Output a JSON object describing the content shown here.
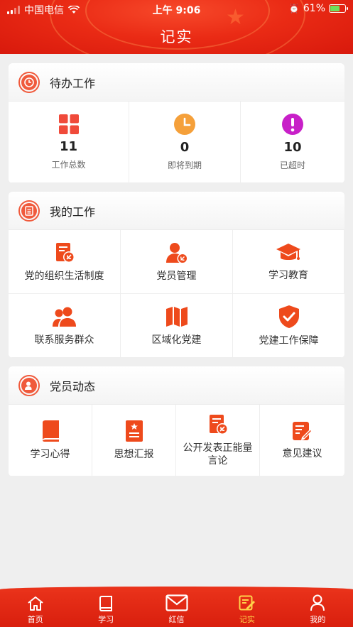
{
  "status_bar": {
    "carrier": "中国电信",
    "time": "上午 9:06",
    "battery": "61%"
  },
  "header": {
    "title": "记实"
  },
  "pending": {
    "title": "待办工作",
    "stats": [
      {
        "value": "11",
        "label": "工作总数",
        "icon": "grid-icon",
        "color": "#f04a3a"
      },
      {
        "value": "0",
        "label": "即将到期",
        "icon": "clock-icon",
        "color": "#f5a03a"
      },
      {
        "value": "10",
        "label": "已超时",
        "icon": "exclamation-icon",
        "color": "#c820c8"
      }
    ]
  },
  "my_work": {
    "title": "我的工作",
    "items": [
      {
        "label": "党的组织生活制度",
        "icon": "party-document-icon"
      },
      {
        "label": "党员管理",
        "icon": "member-icon"
      },
      {
        "label": "学习教育",
        "icon": "graduation-cap-icon"
      },
      {
        "label": "联系服务群众",
        "icon": "people-icon"
      },
      {
        "label": "区域化党建",
        "icon": "map-icon"
      },
      {
        "label": "党建工作保障",
        "icon": "shield-check-icon"
      }
    ]
  },
  "dynamics": {
    "title": "党员动态",
    "items": [
      {
        "label": "学习心得",
        "icon": "book-icon"
      },
      {
        "label": "思想汇报",
        "icon": "report-icon"
      },
      {
        "label": "公开发表正能量言论",
        "icon": "speech-document-icon"
      },
      {
        "label": "意见建议",
        "icon": "edit-note-icon"
      }
    ]
  },
  "tabbar": {
    "tabs": [
      {
        "label": "首页",
        "icon": "home-icon"
      },
      {
        "label": "学习",
        "icon": "book-icon"
      },
      {
        "label": "红信",
        "icon": "mail-icon"
      },
      {
        "label": "记实",
        "icon": "edit-note-icon",
        "active": true
      },
      {
        "label": "我的",
        "icon": "user-icon"
      }
    ]
  },
  "colors": {
    "brand_red": "#e9321a",
    "icon_orange_red": "#ee4a1c",
    "active_tab": "#ffd34a"
  }
}
